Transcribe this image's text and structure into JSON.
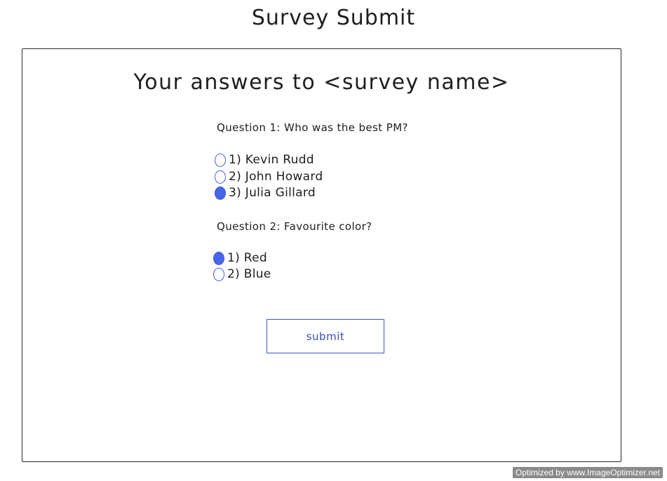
{
  "page": {
    "heading": "Survey Submit"
  },
  "survey": {
    "title": "Your answers to <survey name>",
    "questions": [
      {
        "label": "Question 1: Who was the best PM?",
        "options": [
          {
            "label": "1) Kevin Rudd",
            "selected": false
          },
          {
            "label": "2) John Howard",
            "selected": false
          },
          {
            "label": "3) Julia Gillard",
            "selected": true
          }
        ]
      },
      {
        "label": "Question 2: Favourite color?",
        "options": [
          {
            "label": "1) Red",
            "selected": true
          },
          {
            "label": "2) Blue",
            "selected": false
          }
        ]
      }
    ],
    "submit_label": "submit"
  },
  "colors": {
    "accent": "#4a66e8",
    "border": "#2a2a2a"
  },
  "watermark": "Optimized by www.ImageOptimizer.net"
}
